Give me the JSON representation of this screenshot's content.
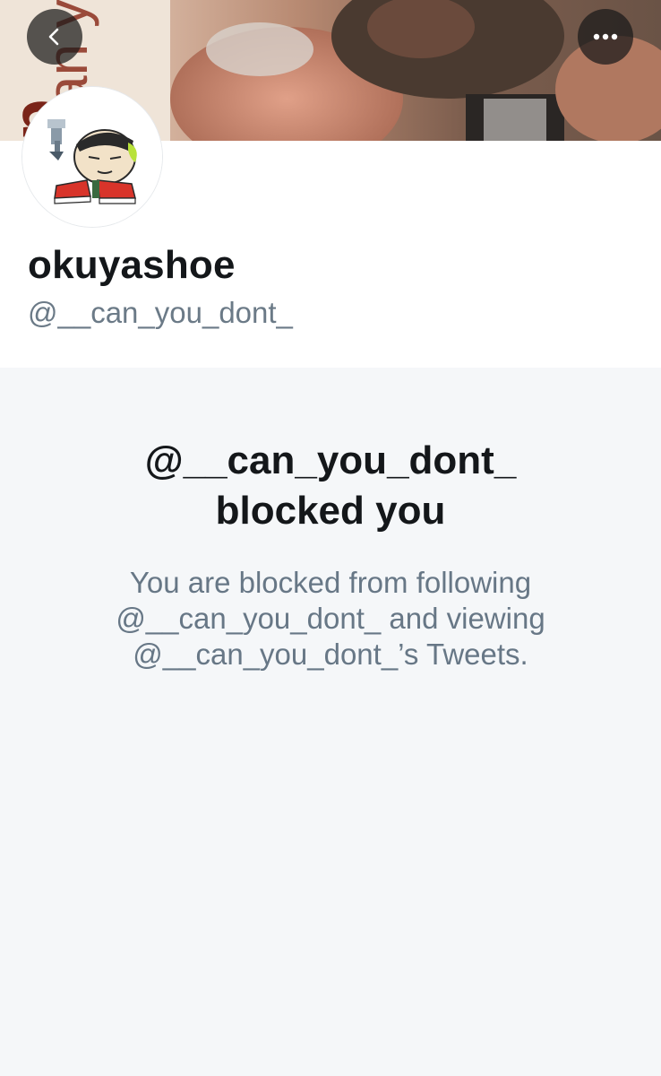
{
  "profile": {
    "display_name": "okuyashoe",
    "handle": "@__can_you_dont_"
  },
  "banner": {
    "text_vertical_1": "can yo",
    "text_vertical_2": "do"
  },
  "icons": {
    "back": "chevron-left-icon",
    "more": "more-horizontal-icon"
  },
  "blocked": {
    "title_line1": "@__can_you_dont_",
    "title_line2": "blocked you",
    "desc_line1": "You are blocked from following",
    "desc_line2": "@__can_you_dont_ and viewing",
    "desc_line3": "@__can_you_dont_’s Tweets."
  },
  "colors": {
    "primary_text": "#14171a",
    "secondary_text": "#677786",
    "section_bg": "#f5f7f9",
    "header_bg": "#ffffff"
  }
}
